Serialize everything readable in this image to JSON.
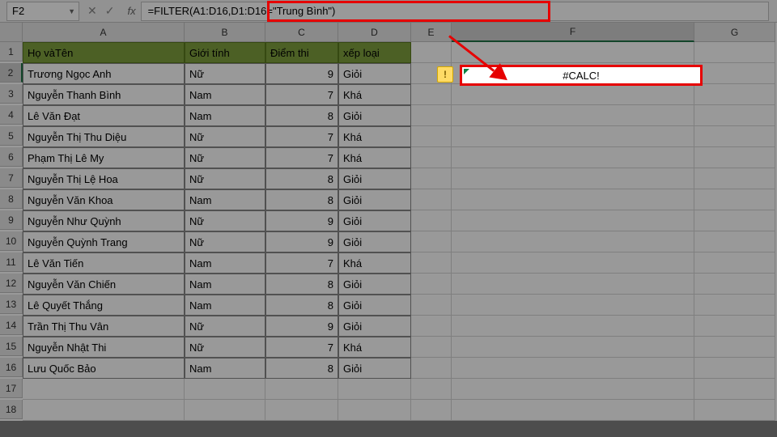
{
  "nameBox": {
    "value": "F2"
  },
  "formulaBar": {
    "value": "=FILTER(A1:D16,D1:D16=\"Trung Bình\")"
  },
  "columns": [
    "A",
    "B",
    "C",
    "D",
    "E",
    "F",
    "G"
  ],
  "headers": {
    "A": "Họ vàTên",
    "B": "Giới tính",
    "C": "Điểm thi",
    "D": "xếp loại"
  },
  "rows": [
    {
      "n": 1
    },
    {
      "n": 2,
      "A": "Trương Ngọc Anh",
      "B": "Nữ",
      "C": "9",
      "D": "Giỏi"
    },
    {
      "n": 3,
      "A": "Nguyễn Thanh Bình",
      "B": "Nam",
      "C": "7",
      "D": "Khá"
    },
    {
      "n": 4,
      "A": "Lê Văn Đạt",
      "B": "Nam",
      "C": "8",
      "D": "Giỏi"
    },
    {
      "n": 5,
      "A": "Nguyễn Thị Thu Diệu",
      "B": "Nữ",
      "C": "7",
      "D": "Khá"
    },
    {
      "n": 6,
      "A": "Phạm Thị Lê My",
      "B": "Nữ",
      "C": "7",
      "D": "Khá"
    },
    {
      "n": 7,
      "A": "Nguyễn Thị Lệ Hoa",
      "B": "Nữ",
      "C": "8",
      "D": "Giỏi"
    },
    {
      "n": 8,
      "A": "Nguyễn Văn Khoa",
      "B": "Nam",
      "C": "8",
      "D": "Giỏi"
    },
    {
      "n": 9,
      "A": "Nguyễn Như Quỳnh",
      "B": "Nữ",
      "C": "9",
      "D": "Giỏi"
    },
    {
      "n": 10,
      "A": "Nguyễn Quỳnh Trang",
      "B": "Nữ",
      "C": "9",
      "D": "Giỏi"
    },
    {
      "n": 11,
      "A": "Lê Văn Tiến",
      "B": "Nam",
      "C": "7",
      "D": "Khá"
    },
    {
      "n": 12,
      "A": "Nguyễn Văn Chiến",
      "B": "Nam",
      "C": "8",
      "D": "Giỏi"
    },
    {
      "n": 13,
      "A": "Lê Quyết Thắng",
      "B": "Nam",
      "C": "8",
      "D": "Giỏi"
    },
    {
      "n": 14,
      "A": "Trần Thị Thu Vân",
      "B": "Nữ",
      "C": "9",
      "D": "Giỏi"
    },
    {
      "n": 15,
      "A": "Nguyễn Nhật Thi",
      "B": "Nữ",
      "C": "7",
      "D": "Khá"
    },
    {
      "n": 16,
      "A": "Lưu Quốc Bảo",
      "B": "Nam",
      "C": "8",
      "D": "Giỏi"
    },
    {
      "n": 17
    },
    {
      "n": 18
    }
  ],
  "errorCell": {
    "value": "#CALC!"
  },
  "errorIndicator": {
    "symbol": "!"
  }
}
